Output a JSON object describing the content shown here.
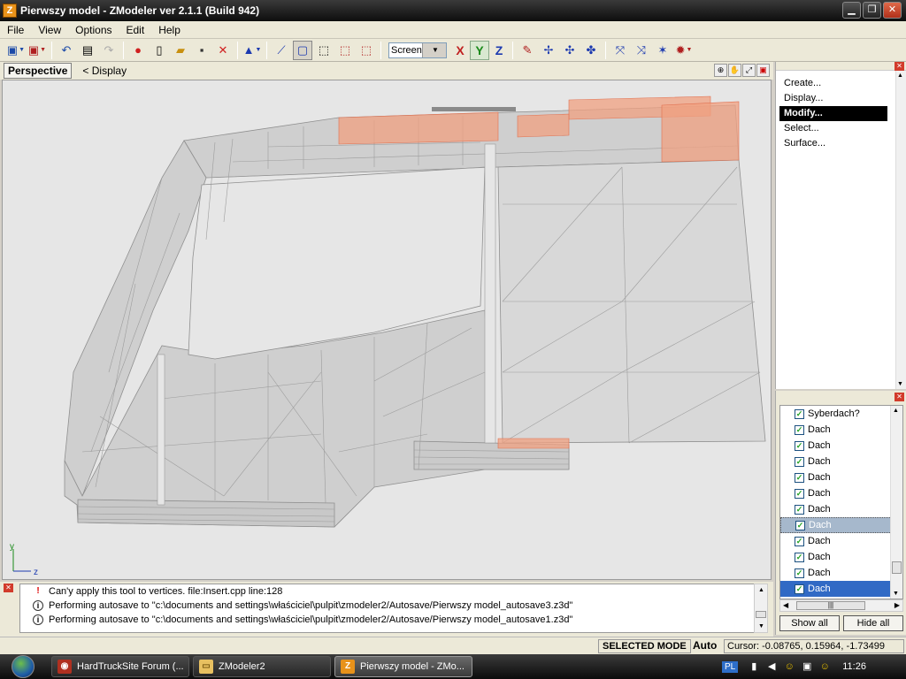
{
  "window": {
    "title": "Pierwszy model - ZModeler ver 2.1.1 (Build 942)",
    "app_icon": "Z",
    "minimize": "▁",
    "maximize": "❐",
    "close": "✕"
  },
  "menu": [
    "File",
    "View",
    "Options",
    "Edit",
    "Help"
  ],
  "toolbar": {
    "space_select": "Screen",
    "axes": {
      "x": "X",
      "y": "Y",
      "z": "Z"
    },
    "axis_colors": {
      "x": "#c02020",
      "y": "#1a8a1a",
      "z": "#1c3ab0"
    }
  },
  "viewport": {
    "tab_label": "Perspective",
    "display_label": "< Display",
    "gizmo": {
      "y": "y",
      "z": "z"
    }
  },
  "command_panel": {
    "items": [
      "Create...",
      "Display...",
      "Modify...",
      "Select...",
      "Surface..."
    ],
    "selected_index": 2
  },
  "object_list": {
    "items": [
      {
        "name": "Syberdach?",
        "checked": true
      },
      {
        "name": "Dach",
        "checked": true
      },
      {
        "name": "Dach",
        "checked": true
      },
      {
        "name": "Dach",
        "checked": true
      },
      {
        "name": "Dach",
        "checked": true
      },
      {
        "name": "Dach",
        "checked": true
      },
      {
        "name": "Dach",
        "checked": true
      },
      {
        "name": "Dach",
        "checked": true,
        "state": "highlighted"
      },
      {
        "name": "Dach",
        "checked": true
      },
      {
        "name": "Dach",
        "checked": true
      },
      {
        "name": "Dach",
        "checked": true
      },
      {
        "name": "Dach",
        "checked": true,
        "state": "selected"
      }
    ],
    "show_all": "Show all",
    "hide_all": "Hide all"
  },
  "log": {
    "lines": [
      {
        "type": "error",
        "icon": "!",
        "text": "Can'y apply this tool to vertices. file:Insert.cpp line:128"
      },
      {
        "type": "info",
        "icon": "i",
        "text": "Performing autosave to \"c:\\documents and settings\\właściciel\\pulpit\\zmodeler2/Autosave/Pierwszy model_autosave3.z3d\""
      },
      {
        "type": "info",
        "icon": "i",
        "text": "Performing autosave to \"c:\\documents and settings\\właściciel\\pulpit\\zmodeler2/Autosave/Pierwszy model_autosave1.z3d\""
      }
    ]
  },
  "status": {
    "mode": "SELECTED MODE",
    "auto": "Auto",
    "cursor": "Cursor: -0.08765, 0.15964, -1.73499"
  },
  "taskbar": {
    "tasks": [
      {
        "label": "HardTruckSite Forum (...",
        "icon": "firefox-icon",
        "color": "#b03020",
        "glyph": "◉"
      },
      {
        "label": "ZModeler2",
        "icon": "folder-icon",
        "color": "#e8c060",
        "glyph": "▭"
      },
      {
        "label": "Pierwszy model - ZMo...",
        "icon": "zmodeler-icon",
        "color": "#e8921a",
        "glyph": "Z",
        "active": true
      }
    ],
    "lang": "PL",
    "clock": "11:26"
  },
  "colors": {
    "mesh_fill": "#cfcfcf",
    "mesh_wire": "#8f8f8f",
    "selected_faces": "#f0a080",
    "viewport_bg": "#e6e6e6"
  }
}
